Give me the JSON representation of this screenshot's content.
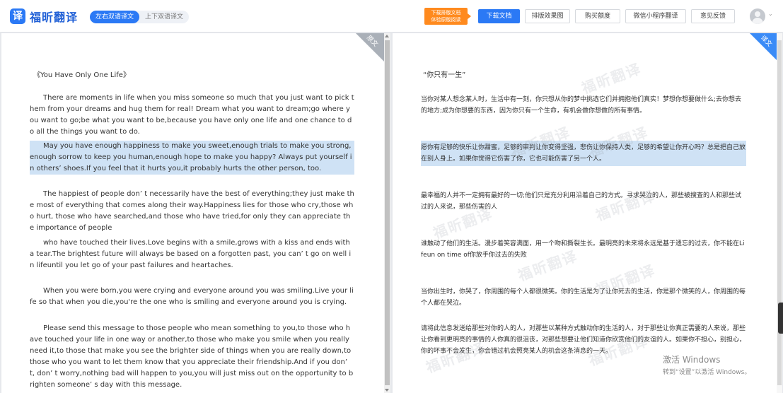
{
  "app": {
    "name": "福昕翻译"
  },
  "header": {
    "modes": [
      "左右双语译文",
      "上下双语译文"
    ],
    "promo_line1": "下载排版文档",
    "promo_line2": "体验原版阅读",
    "buttons": [
      "下载文档",
      "排版效果图",
      "购买额度",
      "微信小程序翻译",
      "意见反馈"
    ]
  },
  "left_pane": {
    "tag": "原文",
    "title": "《You Have Only One Life》",
    "paragraphs": [
      "There are moments in life when you miss someone so much that you just want to pick them from your dreams and hug them for real! Dream what you want to dream;go where you want to go;be what you want to be,because you have only one life and one chance to do all the things you want to do.",
      "May you have enough happiness to make you sweet,enough trials to make you strong,enough sorrow to keep you human,enough hope to make you happy? Always put yourself in others’ shoes.If you feel that it hurts you,it probably hurts the other person, too.",
      "The happiest of people don’ t necessarily have the best of everything;they just make the most of everything that comes along their way.Happiness lies for those who cry,those who hurt, those who have searched,and those who have tried,for only they can appreciate the importance of people",
      "who have touched their lives.Love begins with a smile,grows with a kiss and ends with a tear.The brightest future will always be based on a forgotten past, you can’ t go on well in lifeuntil you let go of your past failures and heartaches.",
      "When you were born,you were crying and everyone around you was smiling.Live your life so that when you die,you're the one who is smiling and everyone around you is crying.",
      "Please send this message to those people who mean something to you,to those who have touched your life in one way or another,to those who make you smile when you really need it,to those that make you see the brighter side of things when you are really down,to those who you want to let them know that you appreciate their friendship.And if you don’ t, don’ t worry,nothing bad will happen to you,you will just miss out on the opportunity to brighten someone’ s day with this message."
    ]
  },
  "right_pane": {
    "tag": "译文",
    "title": "“你只有一生”",
    "paragraphs": [
      "当你对某人想念某人时，生活中有一刻，你只想从你的梦中挑选它们并拥抱他们真实！梦想你想要做什么;去你想去的地方;成为你想要的东西，因为你只有一个生命，有机会做你想做的所有事情。",
      "愿你有足够的快乐让你甜蜜，足够的审判让你变得坚强，悲伤让你保持人类，足够的希望让你开心吗？总是把自己放在别人身上。如果你觉得它伤害了你，它也可能伤害了另一个人。",
      "最幸福的人并不一定拥有最好的一切;他们只是充分利用沿着自己的方式。寻求哭泣的人，那些被搜查的人和那些试过的人来说，那些伤害的人",
      "谁触动了他们的生活。漫步着笑容满面，用一个吻和撕裂生长。最明亮的未来将永远是基于遗忘的过去，你不能在Lifeun on time of你放手你过去的失败",
      "当你出生时，你哭了，你周围的每个人都很微笑。你的生活是为了让你死去的生活，你是那个微笑的人，你周围的每个人都在哭泣。",
      "请将此信息发送给那些对你的人的人，对那些以某种方式触动你的生活的人，对于那些让你真正需要的人来说，那些让你看到更明亮的事情的人你真的很沮丧，对那些想要让他们知道你欣赏他们的友谊的人。如果你不担心，别担心，你的坏事不会发生，你会错过机会照亮某人的机会这条消息的一天。"
    ]
  },
  "watermark": "福昕翻译",
  "os_overlay": {
    "line1": "激活 Windows",
    "line2": "转到“设置”以激活 Windows。"
  }
}
